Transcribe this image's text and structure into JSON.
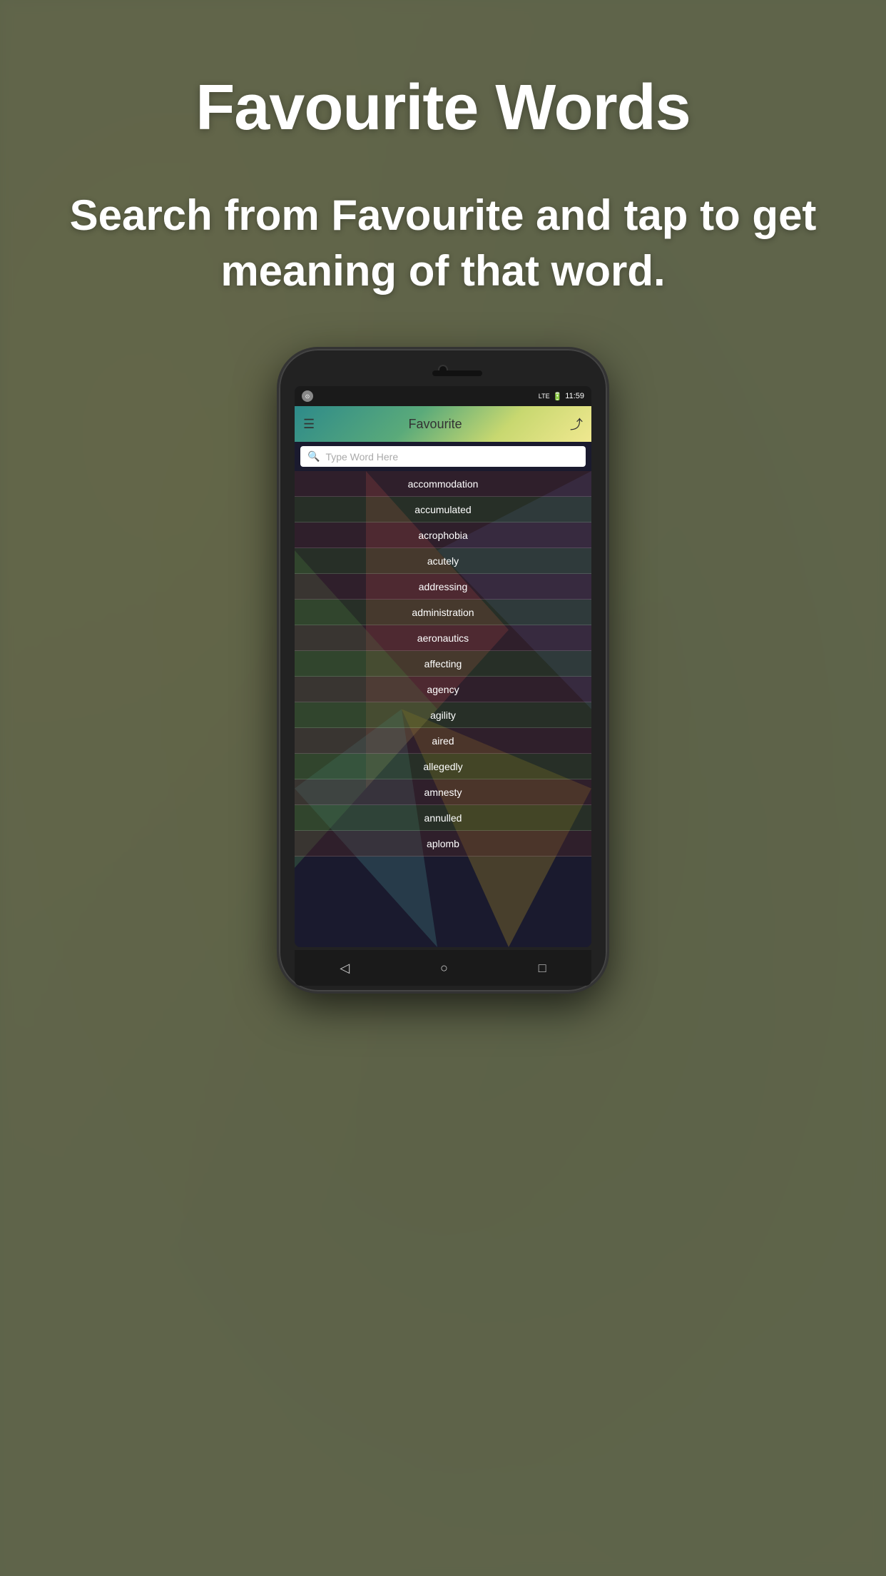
{
  "page": {
    "title": "Favourite Words",
    "subtitle": "Search from Favourite and tap to get meaning of that word."
  },
  "phone": {
    "status_bar": {
      "left_icon": "●",
      "signal": "LTE",
      "battery": "🔋",
      "time": "11:59"
    },
    "app_bar": {
      "title": "Favourite",
      "menu_icon": "☰",
      "share_icon": "⤴"
    },
    "search": {
      "placeholder": "Type Word Here"
    },
    "words": [
      "accommodation",
      "accumulated",
      "acrophobia",
      "acutely",
      "addressing",
      "administration",
      "aeronautics",
      "affecting",
      "agency",
      "agility",
      "aired",
      "allegedly",
      "amnesty",
      "annulled",
      "aplomb"
    ],
    "nav_buttons": {
      "back": "◁",
      "home": "○",
      "recent": "□"
    }
  }
}
